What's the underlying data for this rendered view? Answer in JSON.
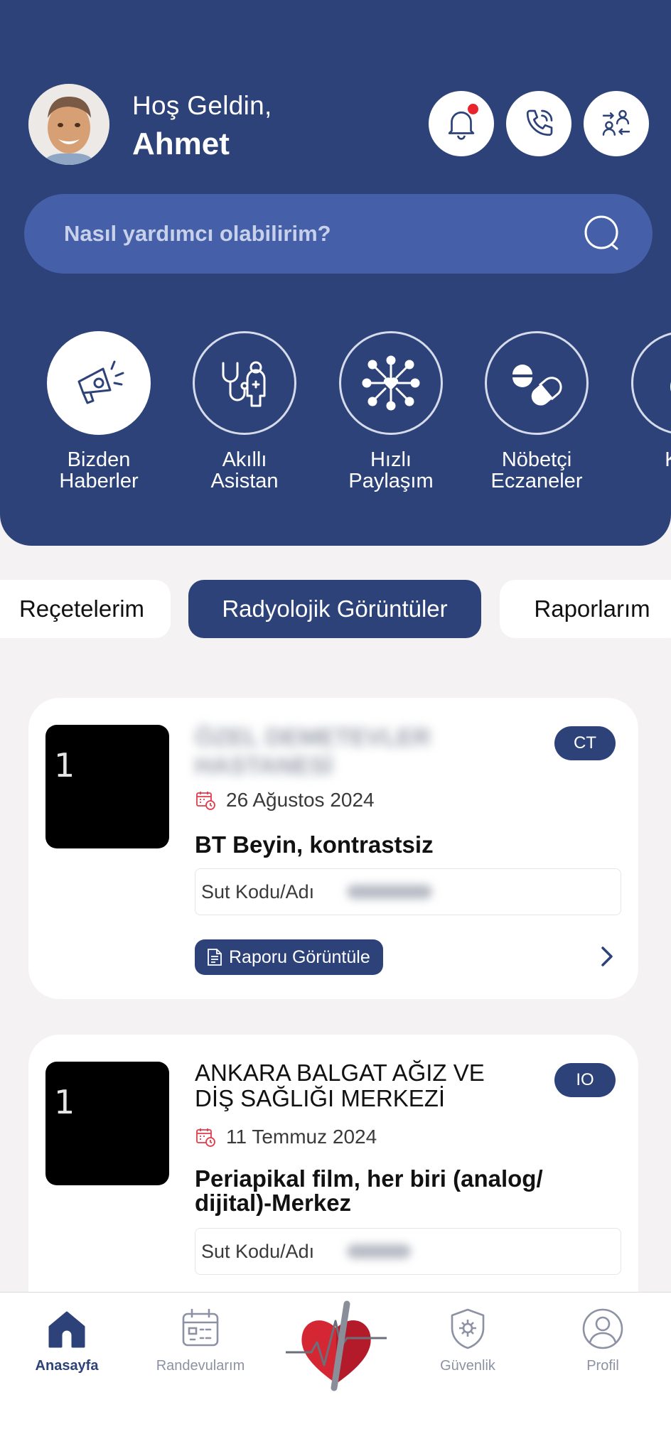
{
  "header": {
    "greeting": "Hoş Geldin,",
    "user_name": "Ahmet"
  },
  "header_actions": [
    {
      "icon": "bell-icon",
      "has_notification": true
    },
    {
      "icon": "phone-icon"
    },
    {
      "icon": "user-switch-icon"
    }
  ],
  "search": {
    "placeholder": "Nasıl yardımcı olabilirim?"
  },
  "quick_actions": [
    {
      "label": "Bizden\nHaberler",
      "icon": "megaphone-icon"
    },
    {
      "label": "Akıllı Asistan",
      "icon": "doctor-stethoscope-icon"
    },
    {
      "label": "Hızlı\nPaylaşım",
      "icon": "network-heart-icon"
    },
    {
      "label": "Nöbetçi\nEczaneler",
      "icon": "pills-icon"
    },
    {
      "label": "Kan",
      "icon": "blood-drop-icon"
    }
  ],
  "tabs": [
    {
      "label": "Reçetelerim",
      "active": false
    },
    {
      "label": "Radyolojik Görüntüler",
      "active": true
    },
    {
      "label": "Raporlarım",
      "active": false
    }
  ],
  "records": [
    {
      "thumb_label": "1",
      "institution_blurred": "ÖZEL DEMETEVLER HASTANESİ",
      "modality": "CT",
      "date": "26 Ağustos 2024",
      "procedure": "BT Beyin, kontrastsiz",
      "sut_label": "Sut Kodu/Adı",
      "report_button": "Raporu Görüntüle"
    },
    {
      "thumb_label": "1",
      "institution": "ANKARA BALGAT AĞIZ VE DİŞ SAĞLIĞI MERKEZİ",
      "modality": "IO",
      "date": "11 Temmuz 2024",
      "procedure": "Periapikal film, her biri (analog/ dijital)-Merkez",
      "sut_label": "Sut Kodu/Adı"
    }
  ],
  "bottom_nav": [
    {
      "label": "Anasayfa",
      "icon": "home-icon",
      "active": true
    },
    {
      "label": "Randevularım",
      "icon": "calendar-icon",
      "active": false
    },
    {
      "label": "",
      "icon": "heart-logo-icon",
      "active": false
    },
    {
      "label": "Güvenlik",
      "icon": "shield-gear-icon",
      "active": false
    },
    {
      "label": "Profil",
      "icon": "profile-icon",
      "active": false
    }
  ],
  "colors": {
    "primary": "#2d4279",
    "search_bg": "#4560a9",
    "background": "#f5f2f3",
    "notification": "#e8252c",
    "date_icon": "#e23c4b"
  }
}
